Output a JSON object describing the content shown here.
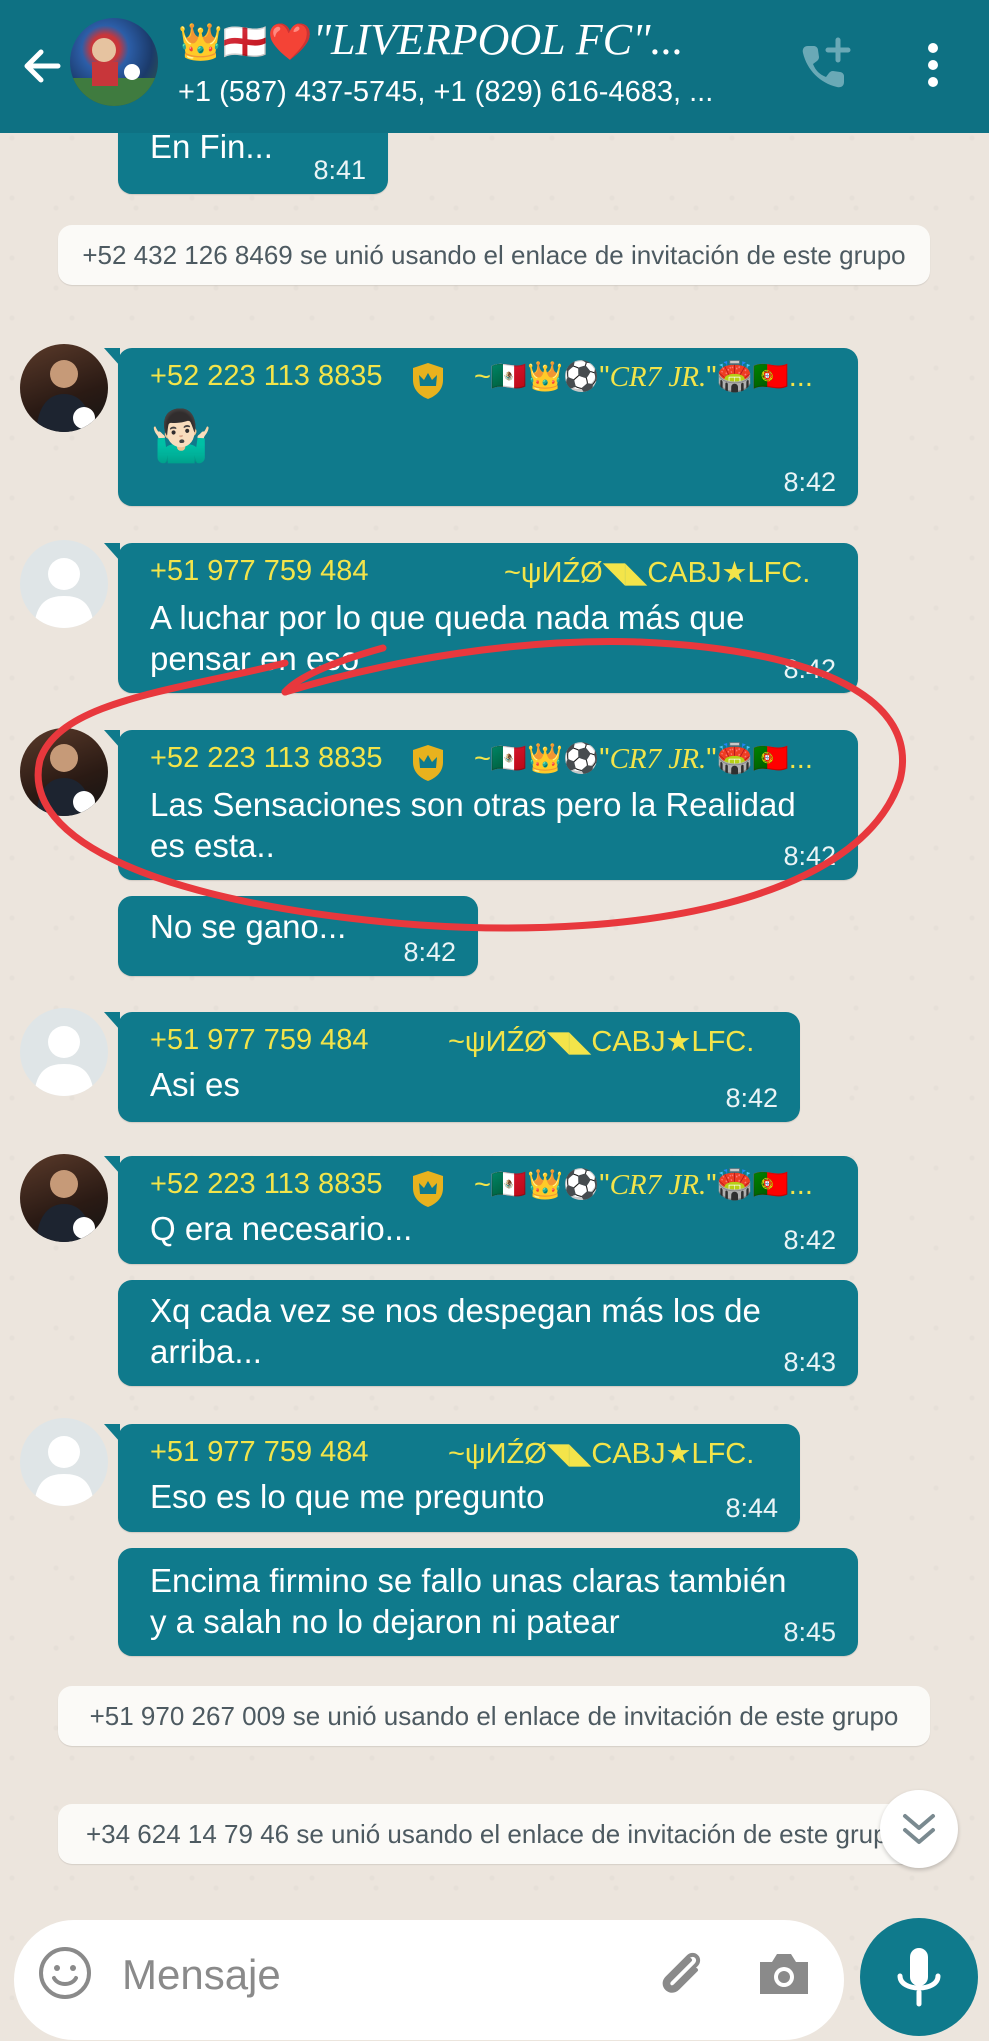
{
  "header": {
    "title_emoji": "👑🏴󠁧󠁢󠁥󠁮󠁧󠁿❤️",
    "title": "\"LIVERPOOL FC\"...",
    "subtitle": "+1 (587) 437-5745, +1 (829) 616-4683, ..."
  },
  "messages": [
    {
      "text": "En Fin...",
      "time": "8:41"
    },
    {
      "system": "+52 432 126 8469 se unió usando el enlace de invitación de este grupo"
    },
    {
      "sender": "+52 223 113 8835",
      "alias_prefix": "~🇲🇽👑⚽\"",
      "alias_name": "CR7 JR.",
      "alias_suffix": "\"🏟️🇵🇹...",
      "text": "🤷🏻‍♂️",
      "time": "8:42"
    },
    {
      "sender": "+51 977 759 484",
      "alias": "~ψИŹØ◥◣CABJ★LFC.",
      "text": "A luchar por lo que queda nada más que pensar en eso",
      "time": "8:42"
    },
    {
      "sender": "+52 223 113 8835",
      "alias_prefix": "~🇲🇽👑⚽\"",
      "alias_name": "CR7 JR.",
      "alias_suffix": "\"🏟️🇵🇹...",
      "text": "Las Sensaciones son otras pero la Realidad es esta..",
      "time": "8:42"
    },
    {
      "text": "No se gano...",
      "time": "8:42"
    },
    {
      "sender": "+51 977 759 484",
      "alias": "~ψИŹØ◥◣CABJ★LFC.",
      "text": "Asi es",
      "time": "8:42"
    },
    {
      "sender": "+52 223 113 8835",
      "alias_prefix": "~🇲🇽👑⚽\"",
      "alias_name": "CR7 JR.",
      "alias_suffix": "\"🏟️🇵🇹...",
      "text": "Q era necesario...",
      "time": "8:42"
    },
    {
      "text": "Xq cada vez se nos despegan más los de arriba...",
      "time": "8:43"
    },
    {
      "sender": "+51 977 759 484",
      "alias": "~ψИŹØ◥◣CABJ★LFC.",
      "text": "Eso es lo que me pregunto",
      "time": "8:44"
    },
    {
      "text": "Encima firmino se fallo unas claras también y a salah no lo dejaron ni patear",
      "time": "8:45"
    },
    {
      "system": "+51 970 267 009 se unió usando el enlace de invitación de este grupo"
    },
    {
      "system": "+34 624 14 79 46 se unió usando el enlace de invitación de este grupo"
    }
  ],
  "input": {
    "placeholder": "Mensaje"
  },
  "colors": {
    "header": "#0e7183",
    "bubble": "#0f7a8c",
    "sender_name": "#f3e44a",
    "chat_background": "#ece5dd",
    "annotation": "#e8383d"
  },
  "icons": [
    "back-arrow-icon",
    "add-call-icon",
    "more-vert-icon",
    "admin-crown-badge-icon",
    "double-chevron-down-icon",
    "emoji-icon",
    "attach-icon",
    "camera-icon",
    "mic-icon"
  ]
}
